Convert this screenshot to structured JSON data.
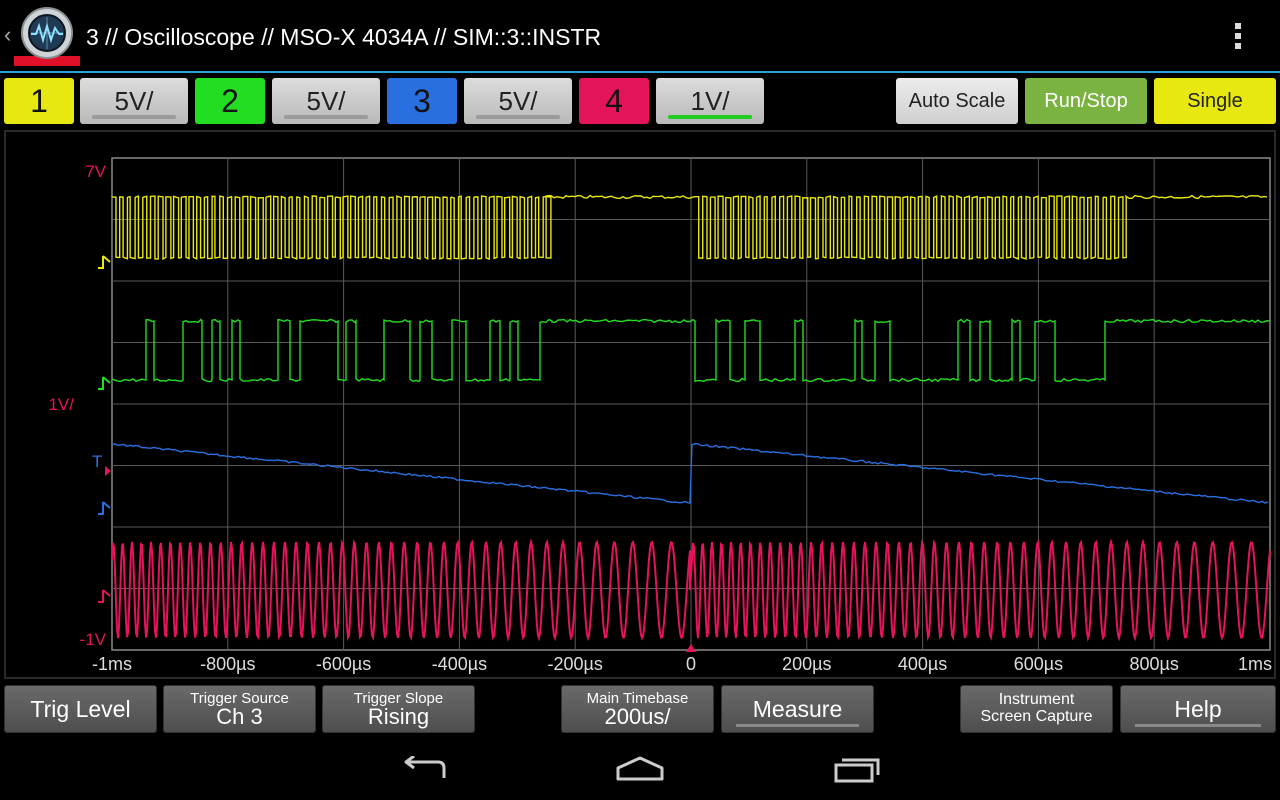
{
  "header": {
    "title": "3 // Oscilloscope // MSO-X 4034A // SIM::3::INSTR",
    "back_glyph": "‹",
    "logo_icon": "oscilloscope-app-icon",
    "menu_icon": "overflow-menu-icon"
  },
  "channels": [
    {
      "label": "1",
      "scale": "5V/",
      "color": "#e8e811",
      "active": false
    },
    {
      "label": "2",
      "scale": "5V/",
      "color": "#22dd22",
      "active": false
    },
    {
      "label": "3",
      "scale": "5V/",
      "color": "#2a6fe0",
      "active": false
    },
    {
      "label": "4",
      "scale": "1V/",
      "color": "#e4145a",
      "active": true
    }
  ],
  "top_actions": {
    "auto_scale": "Auto Scale",
    "run_stop": "Run/Stop",
    "single": "Single"
  },
  "colors": {
    "ch1": "#e8e811",
    "ch2": "#22dd22",
    "ch3": "#2a6fe0",
    "ch4": "#e4145a",
    "accent": "#2aa3d8",
    "run_stop_bg": "#7bb342",
    "single_bg": "#e8e811",
    "grid": "#5a5a5a"
  },
  "scope": {
    "y_labels": {
      "top": "7V",
      "mid": "1V/",
      "bottom": "-1V"
    },
    "trigger_marker": "T",
    "x_ticks": [
      "-1ms",
      "-800µs",
      "-600µs",
      "-400µs",
      "-200µs",
      "0",
      "200µs",
      "400µs",
      "600µs",
      "800µs",
      "1ms"
    ],
    "grid": {
      "divisions_x": 10,
      "divisions_y": 8
    }
  },
  "bottom_bar": {
    "trig_level": "Trig Level",
    "trigger_source": {
      "label": "Trigger Source",
      "value": "Ch 3"
    },
    "trigger_slope": {
      "label": "Trigger Slope",
      "value": "Rising"
    },
    "main_timebase": {
      "label": "Main Timebase",
      "value": "200us/"
    },
    "measure": "Measure",
    "instrument": {
      "line1": "Instrument",
      "line2": "Screen Capture"
    },
    "help": "Help"
  },
  "navbar": {
    "back_icon": "back-icon",
    "home_icon": "home-icon",
    "recents_icon": "recents-icon"
  }
}
